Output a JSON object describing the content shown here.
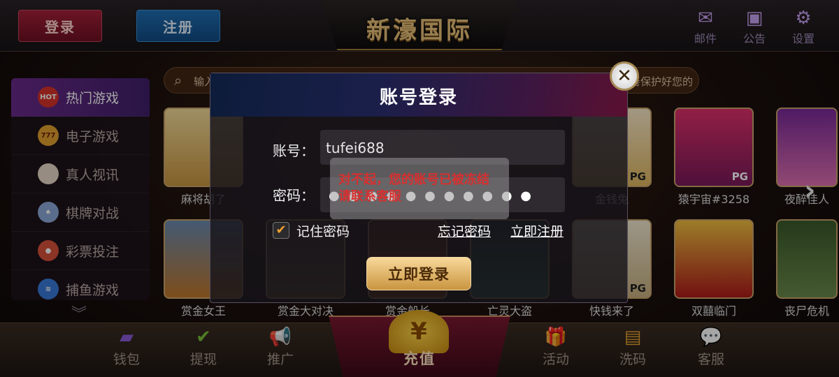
{
  "header": {
    "login_button": "登录",
    "register_button": "注册",
    "logo": "新濠国际",
    "icons": [
      {
        "name": "mail",
        "label": "邮件"
      },
      {
        "name": "announcement",
        "label": "公告"
      },
      {
        "name": "settings",
        "label": "设置"
      }
    ]
  },
  "search": {
    "placeholder": "输入",
    "marquee": "善保护好您的"
  },
  "sidebar": {
    "items": [
      {
        "label": "热门游戏",
        "badge": "HOT"
      },
      {
        "label": "电子游戏",
        "badge": "777"
      },
      {
        "label": "真人视讯",
        "badge": ""
      },
      {
        "label": "棋牌对战",
        "badge": ""
      },
      {
        "label": "彩票投注",
        "badge": ""
      },
      {
        "label": "捕鱼游戏",
        "badge": ""
      }
    ],
    "more_icon": "double-chevron-down-icon"
  },
  "games": [
    {
      "name": "麻将胡了",
      "pg": "",
      "color": "#e7c27a"
    },
    {
      "name": "赏金女王",
      "pg": "",
      "color": "#d98a3a"
    },
    {
      "name": "赏金大对决",
      "pg": "",
      "color": "#6a4a3a"
    },
    {
      "name": "赏金船长",
      "pg": "",
      "color": "#8a3a1a"
    },
    {
      "name": "亡灵大盗",
      "pg": "",
      "color": "#2a5a4a"
    },
    {
      "name": "金钱兔",
      "pg": "PG",
      "color": "#f0d070"
    },
    {
      "name": "快钱来了",
      "pg": "PG",
      "color": "#d8c8a8"
    },
    {
      "name": "猿宇宙#3258",
      "pg": "PG",
      "color": "#e03a6a"
    },
    {
      "name": "双囍临门",
      "pg": "",
      "color": "#c02a2a"
    },
    {
      "name": "夜醉佳人",
      "pg": "",
      "color": "#b03a8a"
    },
    {
      "name": "丧尸危机",
      "pg": "",
      "color": "#4a6a3a"
    }
  ],
  "bottom_nav": [
    {
      "label": "钱包",
      "icon": "wallet-icon"
    },
    {
      "label": "提现",
      "icon": "withdraw-icon"
    },
    {
      "label": "推广",
      "icon": "megaphone-icon"
    },
    {
      "label": "活动",
      "icon": "gift-icon"
    },
    {
      "label": "洗码",
      "icon": "ticket-icon"
    },
    {
      "label": "客服",
      "icon": "chat-icon"
    }
  ],
  "recharge": {
    "label": "充值",
    "coin": "¥"
  },
  "modal": {
    "title": "账号登录",
    "account_label": "账号：",
    "account_value": "tufei688",
    "password_label": "密码：",
    "password_dots": "● ● ● ● ● ● ● ● ● ● ●",
    "remember_label": "记住密码",
    "remember_checked": true,
    "forgot_link": "忘记密码",
    "register_link": "立即注册",
    "login_button": "立即登录",
    "toast": "对不起，您的账号已被冻结请联系客服"
  }
}
